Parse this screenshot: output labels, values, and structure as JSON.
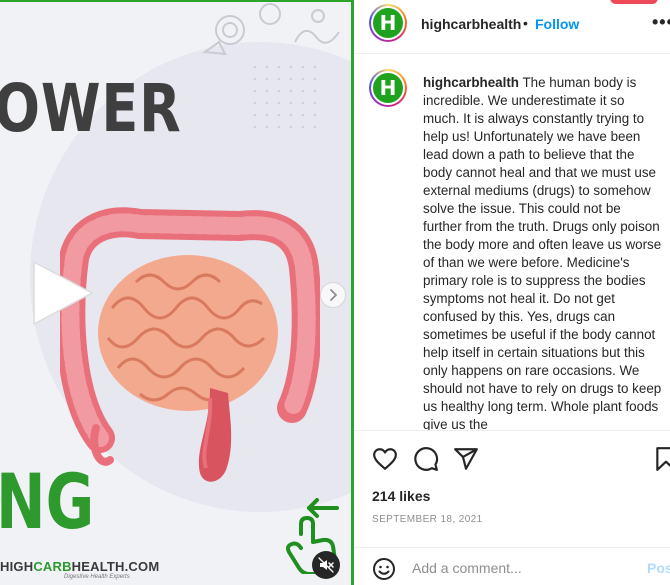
{
  "media": {
    "headline_top": "OWER",
    "headline_bottom": "NG",
    "brand_prefix": "HIGH",
    "brand_accent": "CARB",
    "brand_suffix": "HEALTH.COM",
    "brand_subtitle": "Digestive Health Experts",
    "icons": {
      "play": "play-icon",
      "next": "chevron-right-icon",
      "mute": "speaker-muted-icon",
      "swipe": "swipe-hand-icon"
    }
  },
  "header": {
    "username": "highcarbhealth",
    "separator": "•",
    "follow_label": "Follow",
    "more_label": "•••",
    "avatar_letter": "H"
  },
  "caption": {
    "username": "highcarbhealth",
    "avatar_letter": "H",
    "text": "The human body is incredible. We underestimate it so much. It is always constantly trying to help us! Unfortunately we have been lead down a path to believe that the body cannot heal and that we must use external mediums (drugs) to somehow solve the issue. This could not be further from the truth. Drugs only poison the body more and often leave us worse of than we were before. Medicine's primary role is to suppress the bodies symptoms not heal it. Do not get confused by this. Yes, drugs can sometimes be useful if the body cannot help itself in certain situations but this only happens on rare occasions. We should not have to rely on drugs to keep us healthy long term. Whole plant foods give us the"
  },
  "actions": {
    "likes": "214 likes",
    "date": "SEPTEMBER 18, 2021",
    "icons": [
      "heart-icon",
      "comment-icon",
      "share-icon",
      "bookmark-icon"
    ]
  },
  "comment": {
    "placeholder": "Add a comment...",
    "post_label": "Post"
  },
  "colors": {
    "brand_green": "#2e9a2e",
    "link_blue": "#0095f6",
    "post_disabled": "#b3dbff",
    "text": "#262626",
    "muted": "#8e8e8e"
  }
}
